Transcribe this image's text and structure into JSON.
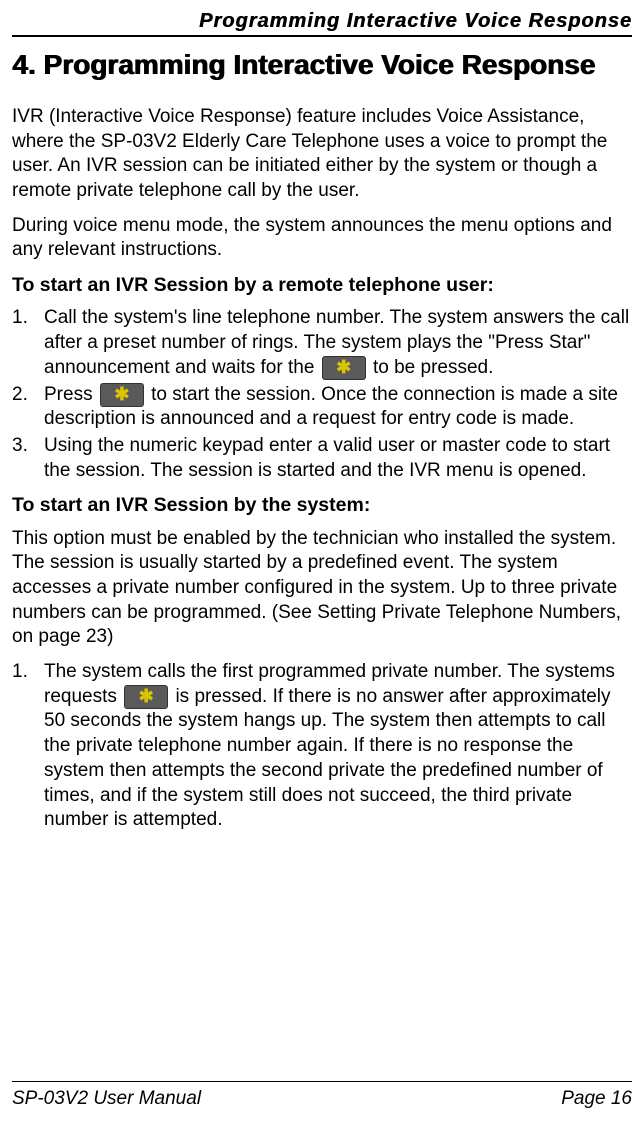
{
  "header": {
    "running_title": "Programming Interactive Voice Response"
  },
  "chapter": {
    "number": "4.",
    "title": "Programming Interactive Voice Response"
  },
  "intro_para_1": "IVR (Interactive Voice Response) feature includes Voice Assistance, where the SP-03V2 Elderly Care Telephone uses a voice to prompt the user. An IVR session can be initiated either by the system or though a remote private telephone call by the user.",
  "intro_para_2": "During voice menu mode, the system announces the menu options and any relevant instructions.",
  "section_a": {
    "heading": "To start an IVR Session by a remote telephone user:",
    "items": [
      {
        "pre": "Call the system's line telephone number. The system answers the call after a preset number of rings. The system plays the \"Press Star\" announcement and waits for the ",
        "post": " to be pressed."
      },
      {
        "pre": "Press ",
        "post": " to start the session. Once the connection is made a site description is announced and a request for entry code is made."
      },
      {
        "text": "Using the numeric keypad enter a valid user or master code to start the session. The session is started and the IVR menu is opened."
      }
    ]
  },
  "section_b": {
    "heading": "To start an IVR Session by the system:",
    "para": "This option must be enabled by the technician who installed the system. The session is usually started by a predefined event. The system accesses a private number configured in the system. Up to three private numbers can be programmed. (See Setting Private Telephone Numbers, on page 23)",
    "items": [
      {
        "pre": "The system calls the first programmed private number. The systems requests ",
        "post": " is pressed. If there is no answer after approximately 50 seconds the system hangs up. The system then attempts to call the private telephone number again. If there is no response the system then attempts the second private the predefined number of times, and if the system still does not succeed, the third private number is attempted."
      }
    ]
  },
  "footer": {
    "left": "SP-03V2 User Manual",
    "right": "Page 16"
  }
}
